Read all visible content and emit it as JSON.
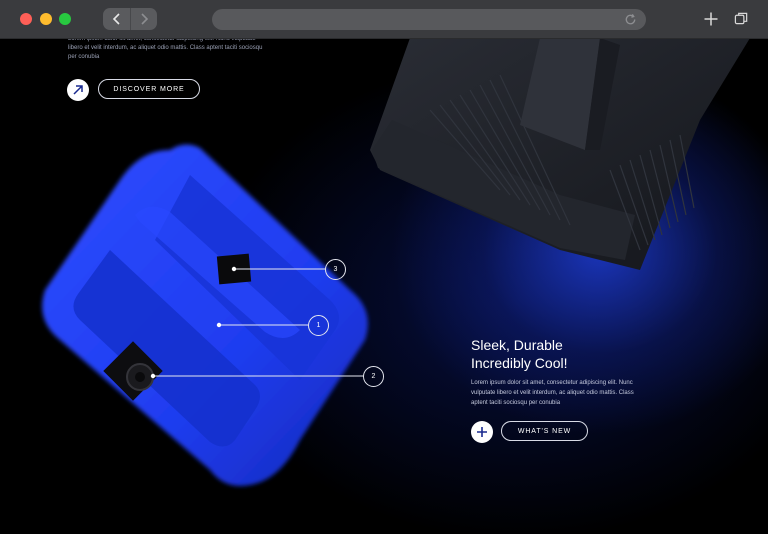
{
  "browser": {
    "url_value": "",
    "icons": {
      "back": "chevron-left-icon",
      "forward": "chevron-right-icon",
      "reload": "reload-icon",
      "new_tab": "plus-icon",
      "tabs": "tabs-overview-icon"
    }
  },
  "hero_top": {
    "body": "Lorem ipsum dolor sit amet, consectetur adipiscing elit. Nunc vulputate libero et velit interdum, ac aliquet odio mattis. Class aptent taciti sociosqu per conubia",
    "cta_label": "DISCOVER MORE",
    "cta_icon": "arrow-up-right-icon"
  },
  "feature": {
    "headline_line1": "Sleek, Durable",
    "headline_line2": "Incredibly Cool!",
    "body": "Lorem ipsum dolor sit amet, consectetur adipiscing elit. Nunc vulputate libero et velit interdum, ac aliquet odio mattis. Class aptent taciti sociosqu per conubia",
    "cta_label": "WHAT'S NEW",
    "cta_icon": "plus-icon"
  },
  "hotspots": [
    {
      "label": "1"
    },
    {
      "label": "2"
    },
    {
      "label": "3"
    }
  ],
  "colors": {
    "speaker_blue": "#1f3df0",
    "speaker_dark": "#1c1e24",
    "glow": "#1e3cd2"
  }
}
